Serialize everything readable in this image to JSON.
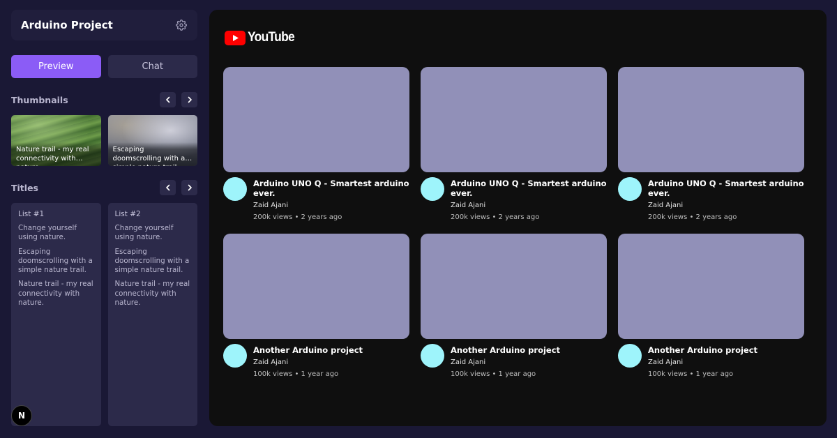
{
  "sidebar": {
    "project_title": "Arduino Project",
    "settings_icon": "gear-icon",
    "mode_buttons": {
      "preview": "Preview",
      "chat": "Chat"
    },
    "thumbnails": {
      "title": "Thumbnails",
      "items": [
        {
          "caption": "Nature trail - my real connectivity with nature."
        },
        {
          "caption": "Escaping doomscrolling with a simple nature trail."
        }
      ]
    },
    "titles": {
      "title": "Titles",
      "lists": [
        {
          "title": "List #1",
          "items": [
            "Change yourself using nature.",
            "Escaping doomscrolling with a simple nature trail.",
            "Nature trail - my real connectivity with nature."
          ]
        },
        {
          "title": "List #2",
          "items": [
            "Change yourself using nature.",
            "Escaping doomscrolling with a simple nature trail.",
            "Nature trail - my real connectivity with nature."
          ]
        }
      ]
    },
    "badge": "N"
  },
  "preview": {
    "logo_text": "YouTube",
    "videos": [
      {
        "title": "Arduino UNO Q - Smartest arduino ever.",
        "channel": "Zaid Ajani",
        "stats": "200k views • 2 years ago"
      },
      {
        "title": "Arduino UNO Q - Smartest arduino ever.",
        "channel": "Zaid Ajani",
        "stats": "200k views • 2 years ago"
      },
      {
        "title": "Arduino UNO Q - Smartest arduino ever.",
        "channel": "Zaid Ajani",
        "stats": "200k views • 2 years ago"
      },
      {
        "title": "Another Arduino project",
        "channel": "Zaid Ajani",
        "stats": "100k views • 1 year ago"
      },
      {
        "title": "Another Arduino project",
        "channel": "Zaid Ajani",
        "stats": "100k views • 1 year ago"
      },
      {
        "title": "Another Arduino project",
        "channel": "Zaid Ajani",
        "stats": "100k views • 1 year ago"
      }
    ]
  },
  "colors": {
    "background": "#1a1835",
    "accent": "#8b5cf6",
    "card": "#2c2a4a",
    "video_placeholder": "#9190b8",
    "avatar": "#9ef4fb",
    "youtube_red": "#ff0000"
  }
}
